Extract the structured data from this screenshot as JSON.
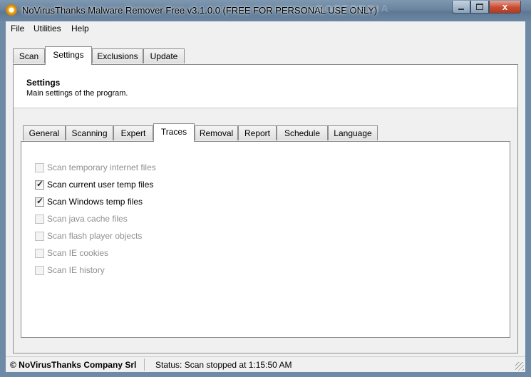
{
  "window": {
    "title": "NoVirusThanks Malware Remover Free v3.1.0.0 (FREE FOR PERSONAL USE ONLY)",
    "watermark": "SOFTPEDIA",
    "close_glyph": "x"
  },
  "menu": {
    "items": [
      "File",
      "Utilities",
      "Help"
    ]
  },
  "main_tabs": [
    {
      "label": "Scan",
      "active": false
    },
    {
      "label": "Settings",
      "active": true
    },
    {
      "label": "Exclusions",
      "active": false
    },
    {
      "label": "Update",
      "active": false
    }
  ],
  "header": {
    "title": "Settings",
    "subtitle": "Main settings of the program."
  },
  "sub_tabs": [
    {
      "label": "General",
      "active": false
    },
    {
      "label": "Scanning",
      "active": false
    },
    {
      "label": "Expert",
      "active": false
    },
    {
      "label": "Traces",
      "active": true
    },
    {
      "label": "Removal",
      "active": false
    },
    {
      "label": "Report",
      "active": false
    },
    {
      "label": "Schedule",
      "active": false
    },
    {
      "label": "Language",
      "active": false
    }
  ],
  "options": [
    {
      "label": "Scan temporary internet files",
      "checked": false,
      "enabled": false
    },
    {
      "label": "Scan current user temp files",
      "checked": true,
      "enabled": true
    },
    {
      "label": "Scan Windows temp files",
      "checked": true,
      "enabled": true
    },
    {
      "label": "Scan java cache files",
      "checked": false,
      "enabled": false
    },
    {
      "label": "Scan flash player objects",
      "checked": false,
      "enabled": false
    },
    {
      "label": "Scan IE cookies",
      "checked": false,
      "enabled": false
    },
    {
      "label": "Scan IE history",
      "checked": false,
      "enabled": false
    }
  ],
  "status": {
    "copyright": "© NoVirusThanks Company Srl",
    "text": "Status:  Scan stopped at 1:15:50 AM"
  }
}
